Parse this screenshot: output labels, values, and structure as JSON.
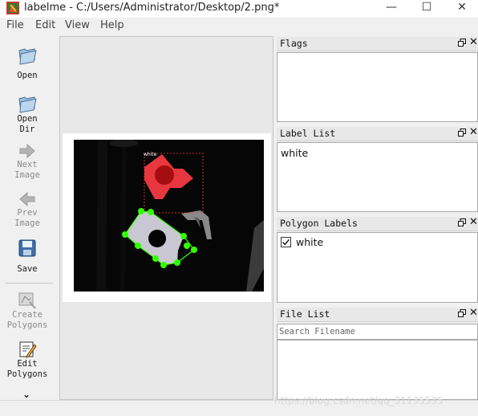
{
  "window": {
    "title": "labelme - C:/Users/Administrator/Desktop/2.png*",
    "minimize": "—",
    "maximize": "☐",
    "close": "✕"
  },
  "menu": [
    "File",
    "Edit",
    "View",
    "Help"
  ],
  "toolbar": {
    "open": "Open",
    "open_dir_1": "Open",
    "open_dir_2": "Dir",
    "next_1": "Next",
    "next_2": "Image",
    "prev_1": "Prev",
    "prev_2": "Image",
    "save": "Save",
    "create_1": "Create",
    "create_2": "Polygons",
    "edit_1": "Edit",
    "edit_2": "Polygons",
    "more": "⌄"
  },
  "docks": {
    "flags": {
      "title": "Flags"
    },
    "label_list": {
      "title": "Label List",
      "items": [
        "white"
      ]
    },
    "polygon_labels": {
      "title": "Polygon Labels",
      "items": [
        {
          "label": "white",
          "checked": true
        }
      ]
    },
    "file_list": {
      "title": "File List",
      "search_placeholder": "Search Filename"
    }
  },
  "canvas": {
    "polygon_label": "white",
    "polygon_color": "#33ff00",
    "selection_color": "#ff3b3b",
    "background_color": "#060606"
  },
  "watermark": "https://blog.csdn.net/qq_31135535"
}
